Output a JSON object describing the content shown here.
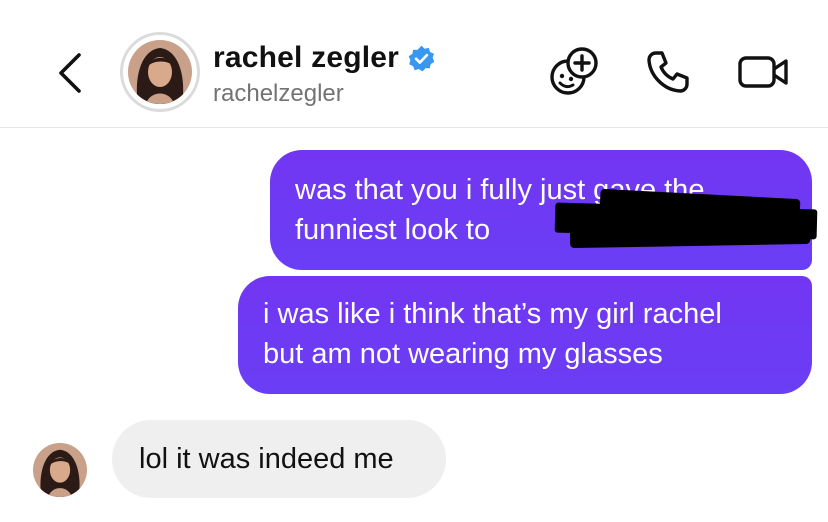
{
  "header": {
    "display_name": "rachel zegler",
    "username": "rachelzegler",
    "verified": true,
    "icons": {
      "back": "chevron-left-icon",
      "verified": "verified-badge-icon",
      "effects": "effects-face-plus-icon",
      "call": "phone-icon",
      "video": "video-camera-icon"
    }
  },
  "messages": [
    {
      "direction": "outgoing",
      "lines": [
        "was that you i fully just gave the",
        "funniest look to"
      ],
      "redacted": true
    },
    {
      "direction": "outgoing",
      "lines": [
        "i was like i think that’s my girl rachel",
        "but am not wearing my glasses"
      ]
    },
    {
      "direction": "incoming",
      "lines": [
        "lol it was indeed me"
      ]
    }
  ],
  "colors": {
    "outgoing_bubble": "#6e3df2",
    "incoming_bubble": "#efefef",
    "verified_blue": "#3897f0"
  }
}
